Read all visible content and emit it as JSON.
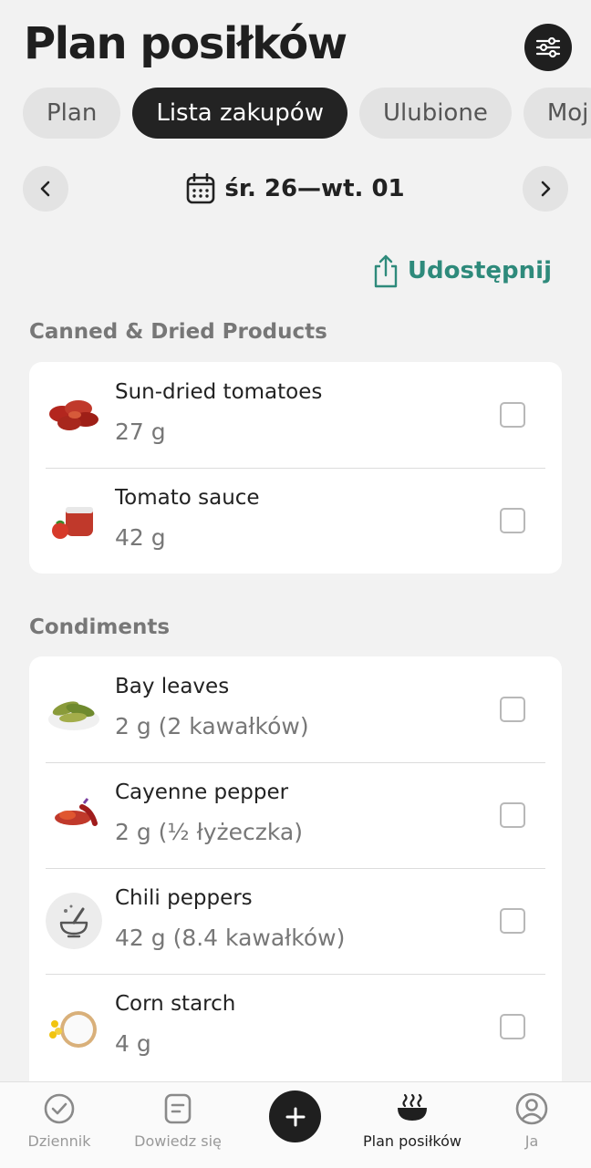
{
  "header": {
    "title": "Plan posiłków"
  },
  "tabs": [
    {
      "label": "Plan",
      "active": false
    },
    {
      "label": "Lista zakupów",
      "active": true
    },
    {
      "label": "Ulubione",
      "active": false
    },
    {
      "label": "Moj",
      "active": false
    }
  ],
  "date_range": {
    "label": "śr. 26—wt. 01"
  },
  "share": {
    "label": "Udostępnij"
  },
  "sections": [
    {
      "title": "Canned & Dried Products",
      "items": [
        {
          "name": "Sun-dried tomatoes",
          "quantity": "27 g",
          "checked": false
        },
        {
          "name": "Tomato sauce",
          "quantity": "42 g",
          "checked": false
        }
      ]
    },
    {
      "title": "Condiments",
      "items": [
        {
          "name": "Bay leaves",
          "quantity": "2 g (2 kawałków)",
          "checked": false
        },
        {
          "name": "Cayenne pepper",
          "quantity": "2 g (½ łyżeczka)",
          "checked": false
        },
        {
          "name": "Chili peppers",
          "quantity": "42 g (8.4 kawałków)",
          "checked": false
        },
        {
          "name": "Corn starch",
          "quantity": "4 g",
          "checked": false
        }
      ]
    }
  ],
  "bottom_nav": {
    "items": [
      {
        "label": "Dziennik",
        "icon": "check-circle-icon",
        "active": false
      },
      {
        "label": "Dowiedz się",
        "icon": "note-icon",
        "active": false
      },
      {
        "label": "Plan posiłków",
        "icon": "meal-bowl-icon",
        "active": true
      },
      {
        "label": "Ja",
        "icon": "profile-icon",
        "active": false
      }
    ],
    "add_icon": "plus-icon"
  },
  "colors": {
    "accent": "#2e8a7b",
    "dark": "#1f1f1f",
    "background": "#f2f2f2"
  }
}
